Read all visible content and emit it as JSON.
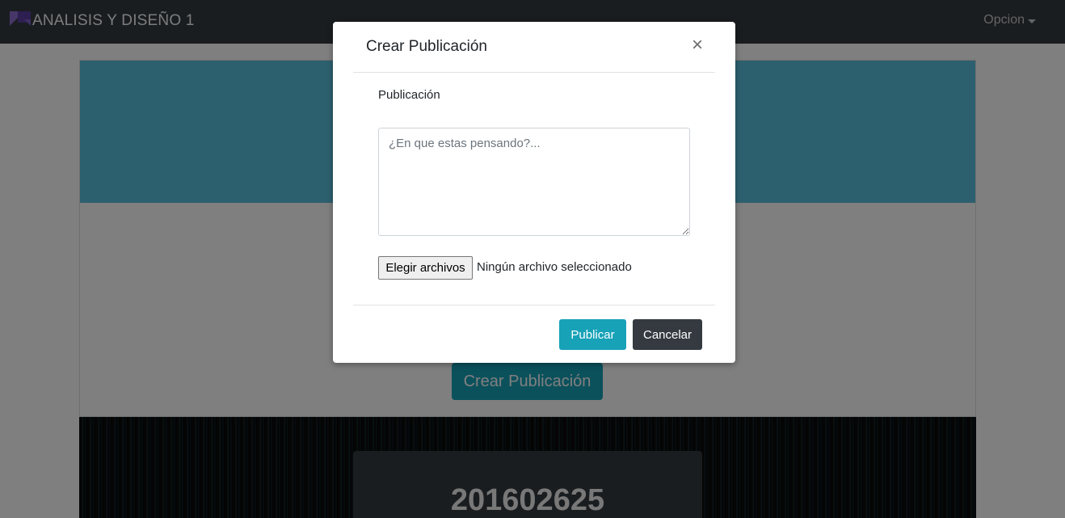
{
  "navbar": {
    "brand": "ANALISIS Y DISEÑO 1",
    "menu_label": "Opcion"
  },
  "background": {
    "create_button_label": "Crear Publicación",
    "profile_id": "201602625"
  },
  "modal": {
    "title": "Crear Publicación",
    "close_symbol": "×",
    "field_label": "Publicación",
    "textarea_placeholder": "¿En que estas pensando?...",
    "textarea_value": "",
    "file_button_label": "Elegir archivos",
    "file_status": "Ningún archivo seleccionado",
    "publish_label": "Publicar",
    "cancel_label": "Cancelar"
  },
  "colors": {
    "navbar": "#343a40",
    "jumbotron": "#5bc0de",
    "accent": "#17a2b8",
    "dark_button": "#343a40",
    "logo": "#6f42c1"
  }
}
